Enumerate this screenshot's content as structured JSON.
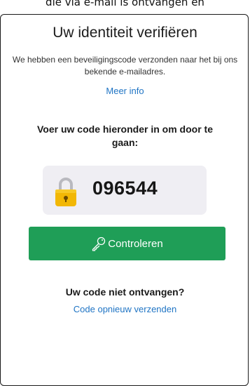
{
  "caption": "die via e-mail is ontvangen en",
  "dialog": {
    "title": "Uw identiteit verifiëren",
    "subtitle": "We hebben een beveiligingscode verzonden naar het bij ons bekende e-mailadres.",
    "more_info_link": "Meer info",
    "instruction": "Voer uw code hieronder in om door te gaan:",
    "code": "096544",
    "verify_button": "Controleren",
    "not_received": "Uw code niet ontvangen?",
    "resend_link": "Code opnieuw verzenden"
  },
  "icons": {
    "lock": "lock-icon",
    "key": "key-icon"
  },
  "colors": {
    "accent_green": "#1f9e57",
    "link_blue": "#1f74c4",
    "code_box_bg": "#efeef3",
    "lock_gold": "#f2b705"
  }
}
